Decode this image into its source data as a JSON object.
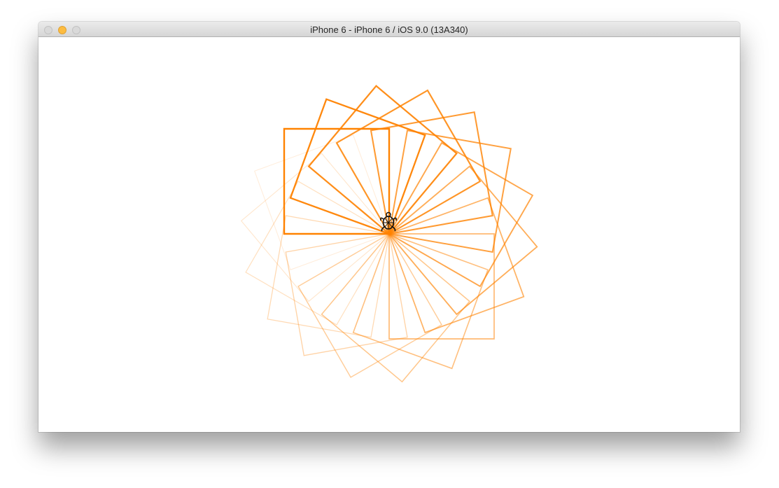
{
  "window": {
    "title": "iPhone 6 - iPhone 6 / iOS 9.0 (13A340)",
    "controls": {
      "close": "close-button",
      "minimize": "minimize-button",
      "zoom": "zoom-button"
    }
  },
  "drawing": {
    "stroke_color": "#ff8200",
    "turtle_icon": "turtle-icon",
    "square_count": 18,
    "rotation_step_deg": 20,
    "description_free": true
  }
}
